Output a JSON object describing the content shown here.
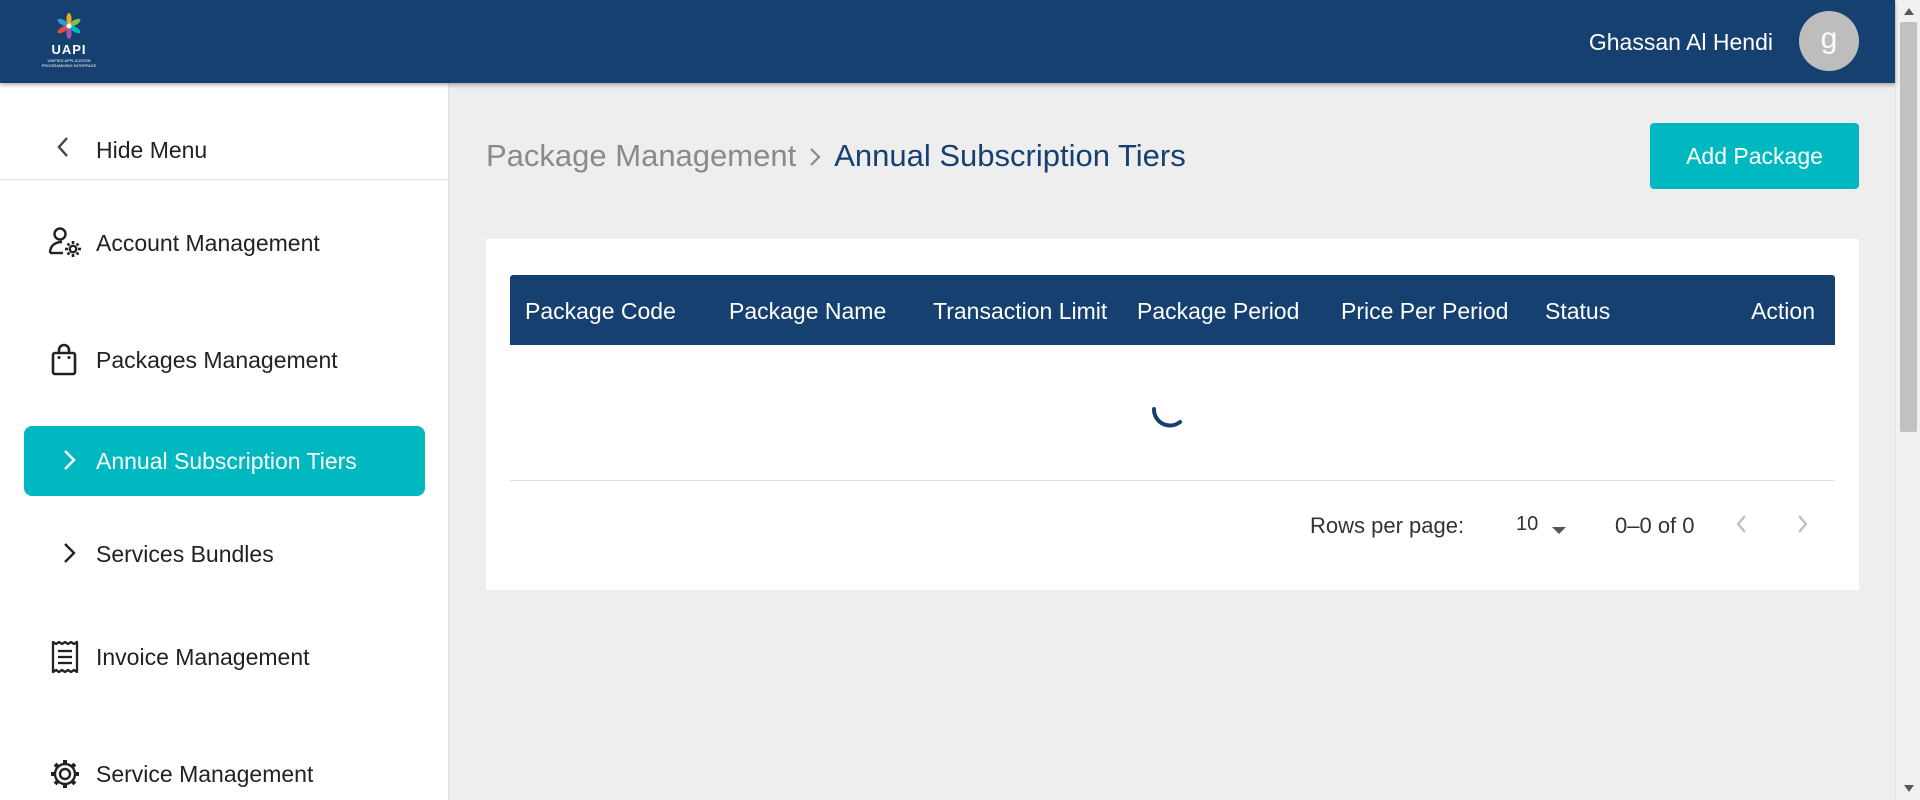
{
  "header": {
    "logo_text": "UAPI",
    "logo_subtitle": "UNIFIED APPLICATION PROGRAMMING INTERFACE",
    "user_name": "Ghassan Al Hendi",
    "avatar_letter": "g"
  },
  "sidebar": {
    "hide_menu_label": "Hide Menu",
    "items": [
      {
        "label": "Account Management",
        "icon": "user-gear-icon"
      },
      {
        "label": "Packages Management",
        "icon": "shopping-bag-icon"
      },
      {
        "label": "Annual Subscription Tiers",
        "icon": "chevron-right-icon",
        "active": true
      },
      {
        "label": "Services Bundles",
        "icon": "chevron-right-icon"
      },
      {
        "label": "Invoice Management",
        "icon": "receipt-icon"
      },
      {
        "label": "Service Management",
        "icon": "gear-icon"
      }
    ]
  },
  "breadcrumb": {
    "parent": "Package Management",
    "current": "Annual Subscription Tiers"
  },
  "actions": {
    "add_package_label": "Add Package"
  },
  "table": {
    "columns": [
      "Package Code",
      "Package Name",
      "Transaction Limit",
      "Package Period",
      "Price Per Period",
      "Status",
      "Action"
    ],
    "rows": [],
    "loading": true
  },
  "pagination": {
    "rows_per_page_label": "Rows per page:",
    "rows_per_page_value": "10",
    "range_text": "0–0 of 0"
  },
  "colors": {
    "primary": "#15406f",
    "accent": "#00b9c0",
    "background": "#eeeeee"
  }
}
